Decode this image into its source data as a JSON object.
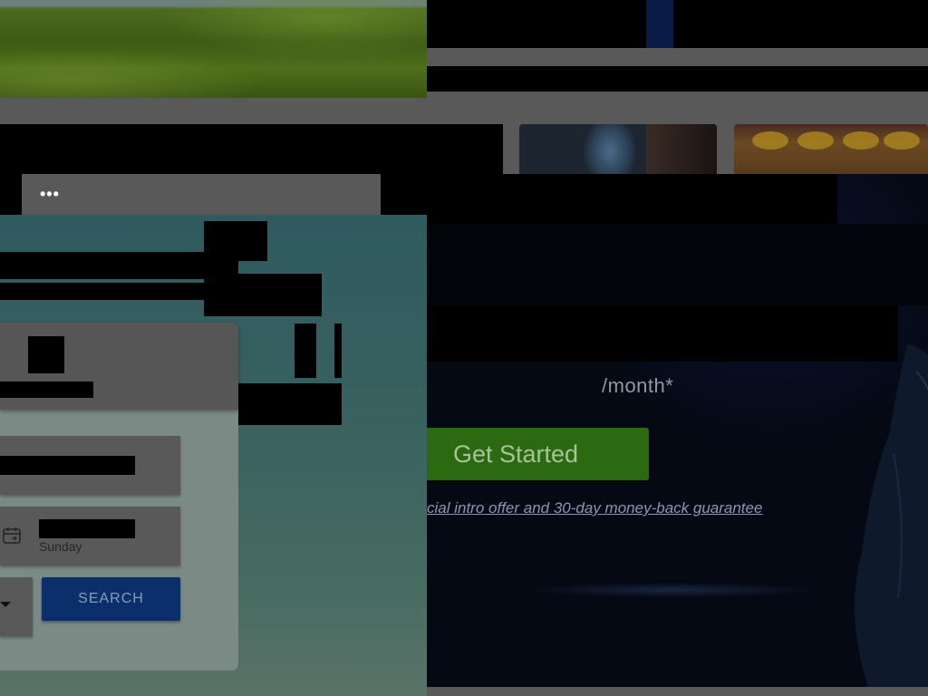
{
  "left_window": {
    "search": {
      "value": "•••"
    },
    "booking": {
      "date_field": {
        "day": "Sunday"
      },
      "search_button_label": "SEARCH"
    }
  },
  "right_window": {
    "hero": {
      "price_suffix": "/month*",
      "cta_label": "Get Started",
      "offer_link": "cial intro offer and 30-day money-back guarantee"
    }
  },
  "colors": {
    "search_button": "#0b2f6b",
    "cta_button": "#2b6a10",
    "hero_bg": "#050914",
    "teal_bg": "#2f5a5f"
  },
  "icons": [
    "calendar-icon",
    "chevron-down-icon"
  ]
}
